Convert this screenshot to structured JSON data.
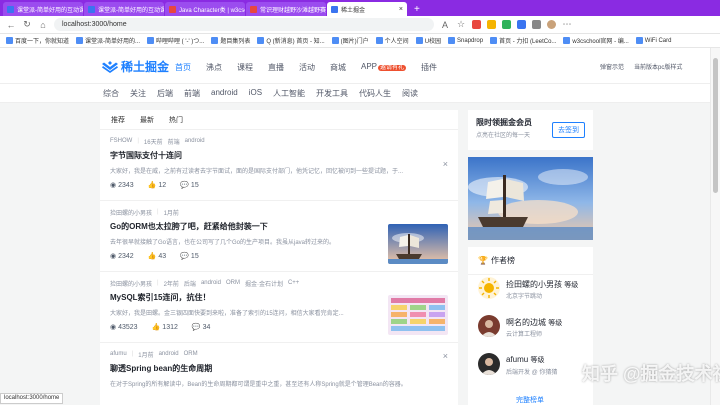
{
  "browser": {
    "tabs": [
      {
        "label": "课堂派-简单好用的互动课堂管理",
        "fav": "blue"
      },
      {
        "label": "课堂派-简单好用的互动课堂管理",
        "fav": "blue"
      },
      {
        "label": "Java Character类 | w3cschool",
        "fav": "red"
      },
      {
        "label": "常识理财越野沙滩越野赛车竞赛汇",
        "fav": "red"
      },
      {
        "label": "稀土掘金",
        "fav": "blue",
        "active": true
      }
    ],
    "url": "localhost:3000/home",
    "bookmarks": [
      "百度一下，你就知道",
      "课堂派-简单好用的...",
      "哔哩哔哩 ( '-' )つ...",
      "题目集列表",
      "Q (新消息) 首页 - 知...",
      "(图片)门户",
      "个人空间",
      "U校园",
      "Snapdrop",
      "首页 - 力扣 (LeetCo...",
      "w3cschool官网 - 编...",
      "WiFi Card"
    ],
    "status_url": "localhost:3000/home"
  },
  "header": {
    "logo_text": "稀土掘金",
    "nav": [
      {
        "label": "首页",
        "active": true
      },
      {
        "label": "沸点"
      },
      {
        "label": "课程"
      },
      {
        "label": "直播"
      },
      {
        "label": "活动"
      },
      {
        "label": "商城"
      },
      {
        "label": "APP",
        "badge": "邀请有礼"
      },
      {
        "label": "插件"
      }
    ],
    "right": [
      "弹窗示范",
      "当前版本pc版样式"
    ]
  },
  "categories": [
    "综合",
    "关注",
    "后端",
    "前端",
    "android",
    "iOS",
    "人工智能",
    "开发工具",
    "代码人生",
    "阅读"
  ],
  "subtabs": [
    {
      "label": "推荐",
      "active": false
    },
    {
      "label": "最新",
      "active": false
    },
    {
      "label": "热门",
      "active": false
    }
  ],
  "articles": [
    {
      "author": "FSHOW",
      "time": "16天前",
      "tags": [
        "前端",
        "android"
      ],
      "title": "字节国际支付十连问",
      "abstract": "大家好，我是在威，之前有过读者去字节面试，面的是国际支付部门，他凭记忆，回忆被问到一些提试题，于...",
      "views": "2343",
      "likes": "12",
      "comments": "15",
      "thumb": false
    },
    {
      "author": "捡田螺的小男孩",
      "time": "1月前",
      "tags": [],
      "title": "Go的ORM也太拉胯了吧，赶紧给他封装一下",
      "abstract": "去年很早就接触了Go语言，也在公司写了几个Go的生产项目。我虽从java转过来的。",
      "views": "2342",
      "likes": "43",
      "comments": "15",
      "thumb": true
    },
    {
      "author": "捡田螺的小男孩",
      "time": "2年前",
      "tags": [
        "后端",
        "android",
        "ORM",
        "掘金·金石计划",
        "C++"
      ],
      "title": "MySQL索引15连问，抗住！",
      "abstract": "大家好，我是田螺。金三银四面快要到来啦，准备了索引的15连问，相信大家看完肯定...",
      "views": "43523",
      "likes": "1312",
      "comments": "34",
      "thumb": true
    },
    {
      "author": "afumu",
      "time": "1月前",
      "tags": [
        "android",
        "ORM"
      ],
      "title": "聊透Spring bean的生命周期",
      "abstract": "在对于Spring的所有解读中，Bean的生命周期都可谓是重中之重，甚至还有人称Spring就是个管理Bean的容器。",
      "views": "",
      "likes": "",
      "comments": "",
      "thumb": false
    }
  ],
  "vip": {
    "title": "限时领掘金会员",
    "subtitle": "点亮在社区的每一天",
    "button": "去签到"
  },
  "authors": {
    "heading": "作者榜",
    "list": [
      {
        "name": "捡田螺的小男孩",
        "level": "等级",
        "desc": "北京字节跳动"
      },
      {
        "name": "啊名的边城",
        "level": "等级",
        "desc": "云计算工程师"
      },
      {
        "name": "afumu",
        "level": "等级",
        "desc": "后端开发 @ 你猜猜"
      }
    ],
    "more": "完整榜单"
  },
  "watermark": "知乎 @掘金技术社区"
}
